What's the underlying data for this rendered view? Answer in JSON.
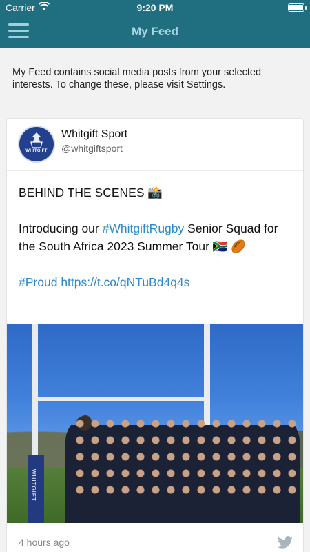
{
  "status_bar": {
    "carrier": "Carrier",
    "time": "9:20 PM"
  },
  "nav": {
    "title": "My Feed",
    "menu_icon": "hamburger-menu-icon"
  },
  "intro": {
    "text": "My Feed contains social media posts from your selected interests. To change these, please visit Settings."
  },
  "post": {
    "author_name": "Whitgift Sport",
    "author_handle": "@whitgiftsport",
    "avatar_text": "WHITGIFT",
    "line1": "BEHIND THE SCENES 📸",
    "line2_prefix": "Introducing our ",
    "line2_hashtag": "#WhitgiftRugby",
    "line2_suffix": " Senior Squad for the South Africa 2023 Summer Tour 🇿🇦 🏉",
    "line3_hashtag": "#Proud",
    "line3_link": "https://t.co/qNTuBd4q4s",
    "photo_text": "WHITGIFT",
    "timestamp": "4 hours ago",
    "source_icon": "twitter-bird-icon"
  },
  "colors": {
    "nav_background": "#1f6f80",
    "link": "#2a8acb"
  }
}
